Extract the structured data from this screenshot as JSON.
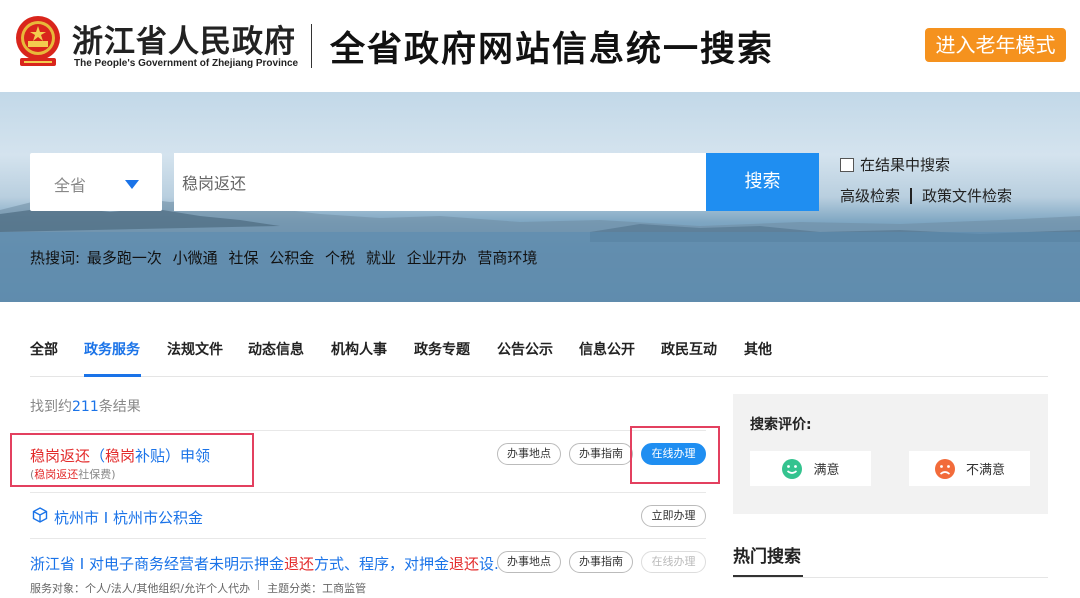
{
  "header": {
    "gov_name": "浙江省人民政府",
    "gov_name_en": "The People's Government of Zhejiang Province",
    "site_title": "全省政府网站信息统一搜索",
    "elder_mode": "进入老年模式"
  },
  "search": {
    "region": "全省",
    "query": "稳岗返还",
    "button": "搜索",
    "in_results": "在结果中搜索",
    "advanced": "高级检索",
    "policy_docs": "政策文件检索",
    "hot_label": "热搜词:",
    "hot_words": [
      "最多跑一次",
      "小微通",
      "社保",
      "公积金",
      "个税",
      "就业",
      "企业开办",
      "营商环境"
    ]
  },
  "tabs": [
    "全部",
    "政务服务",
    "法规文件",
    "动态信息",
    "机构人事",
    "政务专题",
    "公告公示",
    "信息公开",
    "政民互动",
    "其他"
  ],
  "active_tab": "政务服务",
  "results_count": {
    "prefix": "找到约",
    "num": "211",
    "suffix": "条结果"
  },
  "results": [
    {
      "title_hl": "稳岗返还",
      "title_mid": "（",
      "title_hl2": "稳岗",
      "title_rest": "补贴）申领",
      "sub_open": "(",
      "sub_hl": "稳岗返还",
      "sub_rest": "社保费)",
      "actions": [
        "办事地点",
        "办事指南",
        "在线办理"
      ]
    },
    {
      "title_a": "杭州市",
      "title_sep": "I",
      "title_b": "杭州市公积金",
      "actions": [
        "立即办理"
      ]
    },
    {
      "title_a": "浙江省",
      "title_b": "I 对电子商务经营者未明示押金",
      "title_hl": "退还",
      "title_c": "方式、程序，对押金",
      "title_hl2": "退还",
      "title_d": "设...",
      "meta_a": "服务对象：个人/法人/其他组织/允许个人代办",
      "meta_b": "主题分类：工商监管",
      "actions": [
        "办事地点",
        "办事指南",
        "在线办理"
      ]
    }
  ],
  "evaluation": {
    "title": "搜索评价:",
    "satisfied": "满意",
    "unsatisfied": "不满意"
  },
  "hot_search_title": "热门搜索",
  "colors": {
    "brand_blue": "#1f8ef1",
    "highlight_red": "#e32b2b",
    "elder_orange": "#f5921e",
    "annotation_box": "#e3405f"
  }
}
